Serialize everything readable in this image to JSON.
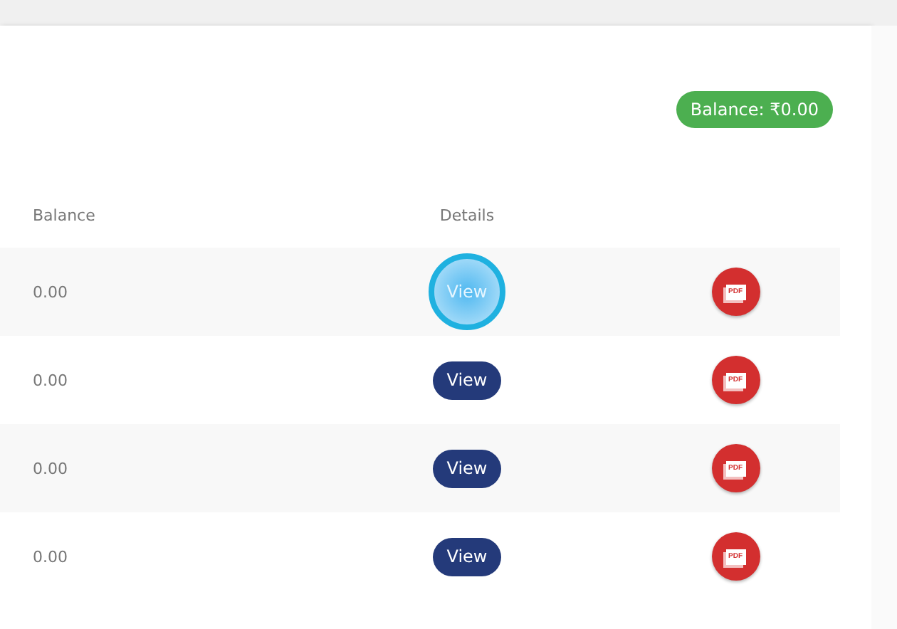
{
  "balance_badge": "Balance: ₹0.00",
  "table": {
    "columns": [
      "Balance",
      "Details"
    ],
    "rows": [
      {
        "balance": "0.00",
        "details": "View",
        "focused": true,
        "pdf": "PDF"
      },
      {
        "balance": "0.00",
        "details": "View",
        "focused": false,
        "pdf": "PDF"
      },
      {
        "balance": "0.00",
        "details": "View",
        "focused": false,
        "pdf": "PDF"
      },
      {
        "balance": "0.00",
        "details": "View",
        "focused": false,
        "pdf": "PDF"
      }
    ]
  }
}
